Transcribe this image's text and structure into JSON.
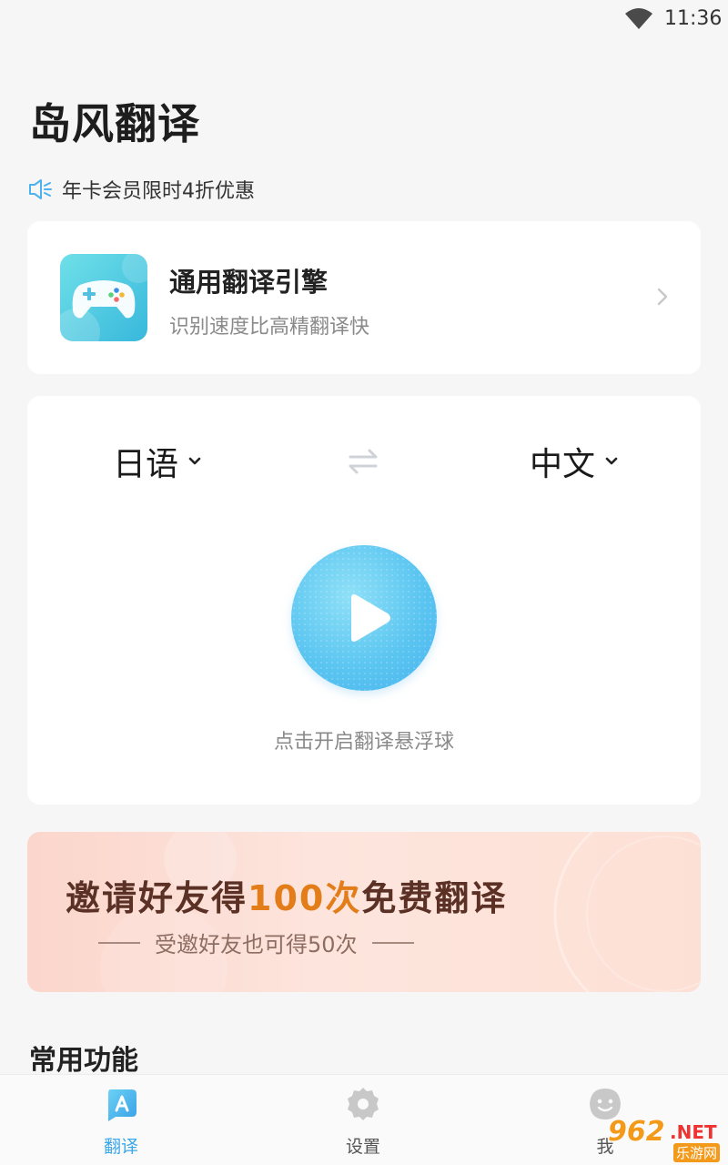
{
  "status_bar": {
    "time": "11:36",
    "wifi_icon": "wifi-icon"
  },
  "app_title": "岛风翻译",
  "promo": {
    "icon": "speaker-icon",
    "text": "年卡会员限时4折优惠"
  },
  "engine": {
    "icon": "gamepad-icon",
    "name": "通用翻译引擎",
    "description": "识别速度比高精翻译快",
    "chevron_icon": "chevron-right-icon"
  },
  "translator": {
    "source_language": "日语",
    "target_language": "中文",
    "swap_icon": "swap-arrows-icon",
    "float_button_icon": "play-icon",
    "float_caption": "点击开启翻译悬浮球"
  },
  "invite_banner": {
    "title_prefix": "邀请好友得",
    "title_highlight": "100次",
    "title_suffix": "免费翻译",
    "subtitle": "受邀好友也可得50次"
  },
  "section_title": "常用功能",
  "tab_bar": {
    "tabs": [
      {
        "label": "翻译",
        "icon": "translate-tab-icon",
        "active": true
      },
      {
        "label": "设置",
        "icon": "gear-icon",
        "active": false
      },
      {
        "label": "我",
        "icon": "smiley-icon",
        "active": false
      }
    ]
  },
  "watermark": {
    "main": "962",
    "suffix": ".NET",
    "caption": "乐游网"
  },
  "colors": {
    "accent": "#3aa7e8",
    "float_button": "#5cc6f1",
    "banner_highlight": "#e27d1a",
    "banner_text": "#5b3126"
  }
}
